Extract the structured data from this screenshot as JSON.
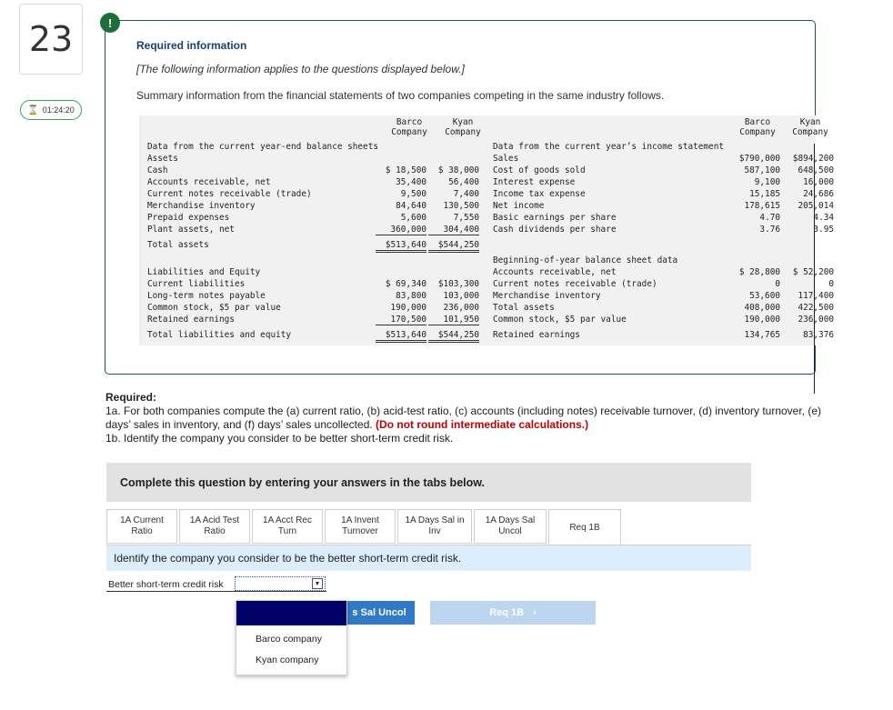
{
  "question_number": "23",
  "timer": "01:24:20",
  "alert_glyph": "!",
  "info": {
    "title": "Required information",
    "note": "[The following information applies to the questions displayed below.]",
    "summary": "Summary information from the financial statements of two companies competing in the same industry follows."
  },
  "table": {
    "left_headers": {
      "barco": "Barco\nCompany",
      "kyan": "Kyan\nCompany"
    },
    "right_headers": {
      "barco": "Barco\nCompany",
      "kyan": "Kyan\nCompany"
    },
    "balance_title": "Data from the current year-end balance sheets",
    "assets_label": "Assets",
    "assets_rows": [
      {
        "label": "Cash",
        "barco": "$ 18,500",
        "kyan": "$ 38,000"
      },
      {
        "label": "Accounts receivable, net",
        "barco": "35,400",
        "kyan": "56,400"
      },
      {
        "label": "Current notes receivable (trade)",
        "barco": "9,500",
        "kyan": "7,400"
      },
      {
        "label": "Merchandise inventory",
        "barco": "84,640",
        "kyan": "130,500"
      },
      {
        "label": "Prepaid expenses",
        "barco": "5,600",
        "kyan": "7,550"
      },
      {
        "label": "Plant assets, net",
        "barco": "360,000",
        "kyan": "304,400"
      }
    ],
    "total_assets": {
      "label": "Total assets",
      "barco": "$513,640",
      "kyan": "$544,250"
    },
    "liab_title": "Liabilities and Equity",
    "liab_rows": [
      {
        "label": "Current liabilities",
        "barco": "$ 69,340",
        "kyan": "$103,300"
      },
      {
        "label": "Long-term notes payable",
        "barco": "83,800",
        "kyan": "103,000"
      },
      {
        "label": "Common stock, $5 par value",
        "barco": "190,000",
        "kyan": "236,000"
      },
      {
        "label": "Retained earnings",
        "barco": "170,500",
        "kyan": "101,950"
      }
    ],
    "total_liab": {
      "label": "Total liabilities and equity",
      "barco": "$513,640",
      "kyan": "$544,250"
    },
    "income_title": "Data from the current year’s income statement",
    "income_rows": [
      {
        "label": "Sales",
        "barco": "$790,000",
        "kyan": "$894,200"
      },
      {
        "label": "Cost of goods sold",
        "barco": "587,100",
        "kyan": "648,500"
      },
      {
        "label": "Interest expense",
        "barco": "9,100",
        "kyan": "16,000"
      },
      {
        "label": "Income tax expense",
        "barco": "15,185",
        "kyan": "24,686"
      },
      {
        "label": "Net income",
        "barco": "178,615",
        "kyan": "205,014"
      },
      {
        "label": "Basic earnings per share",
        "barco": "4.70",
        "kyan": "4.34"
      },
      {
        "label": "Cash dividends per share",
        "barco": "3.76",
        "kyan": "3.95"
      }
    ],
    "begin_title": "Beginning-of-year balance sheet data",
    "begin_rows": [
      {
        "label": "Accounts receivable, net",
        "barco": "$ 28,800",
        "kyan": "$ 52,200"
      },
      {
        "label": "Current notes receivable (trade)",
        "barco": "0",
        "kyan": "0"
      },
      {
        "label": "Merchandise inventory",
        "barco": "53,600",
        "kyan": "117,400"
      },
      {
        "label": "Total assets",
        "barco": "408,000",
        "kyan": "422,500"
      },
      {
        "label": "Common stock, $5 par value",
        "barco": "190,000",
        "kyan": "236,000"
      },
      {
        "label": "Retained earnings",
        "barco": "134,765",
        "kyan": "83,376"
      }
    ]
  },
  "required": {
    "heading": "Required:",
    "line1a": "1a. For both companies compute the (a) current ratio, (b) acid-test ratio, (c) accounts (including notes) receivable turnover, (d) inventory turnover, (e) days’ sales in inventory, and (f) days’ sales uncollected. ",
    "line1a_red": "(Do not round intermediate calculations.)",
    "line1b": "1b. Identify the company you consider to be better short-term credit risk."
  },
  "complete_bar": "Complete this question by entering your answers in the tabs below.",
  "tabs": [
    {
      "label": "1A Current\nRatio"
    },
    {
      "label": "1A Acid Test\nRatio"
    },
    {
      "label": "1A Acct Rec\nTurn"
    },
    {
      "label": "1A Invent\nTurnover"
    },
    {
      "label": "1A Days Sal in\nInv"
    },
    {
      "label": "1A Days Sal\nUncol"
    },
    {
      "label": "Req 1B"
    }
  ],
  "identify_text": "Identify the company you consider to be the better short-term credit risk.",
  "select_label": "Better short-term credit risk",
  "dropdown_options": [
    "Barco company",
    "Kyan company"
  ],
  "prev_button": "s Sal Uncol",
  "next_button": "Req 1B",
  "next_chevron": "›",
  "select_arrow": "▼",
  "hourglass_glyph": "⌛"
}
